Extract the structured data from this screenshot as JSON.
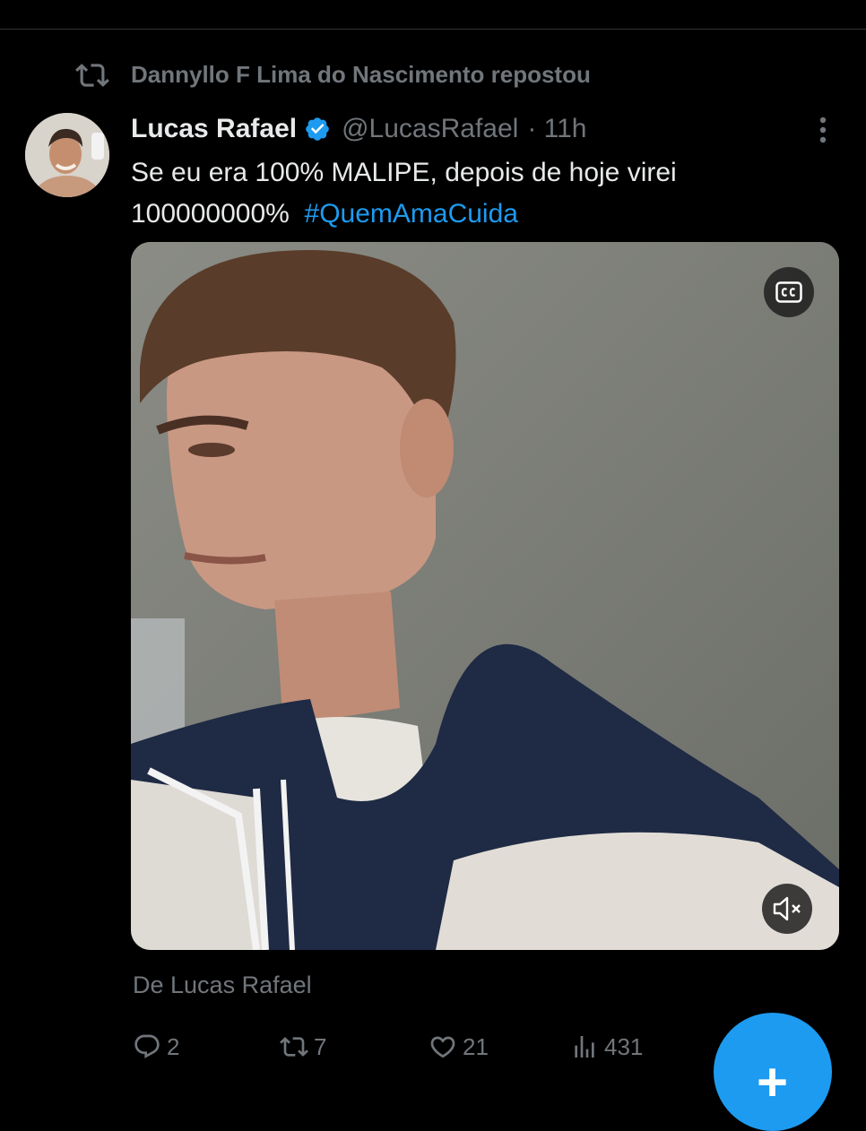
{
  "repost": {
    "text": "Dannyllo F Lima do Nascimento repostou",
    "icon": "repost-icon"
  },
  "tweet": {
    "author_name": "Lucas Rafael",
    "author_handle": "@LucasRafael",
    "time": "· 11h",
    "verified": true,
    "text_line1": "Se eu era 100% MALIPE, depois de hoje virei",
    "text_line2": "100000000%",
    "hashtag": "#QuemAmaCuida",
    "from_label": "De Lucas Rafael"
  },
  "media": {
    "cc_icon": "closed-captions-icon",
    "mute_icon": "muted-speaker-icon"
  },
  "stats": {
    "replies": "2",
    "reposts": "7",
    "likes": "21",
    "views": "431"
  },
  "colors": {
    "background": "#000000",
    "text": "#e7e9ea",
    "muted": "#71767b",
    "accent": "#1d9bf0"
  },
  "fab": {
    "symbol": "+"
  }
}
